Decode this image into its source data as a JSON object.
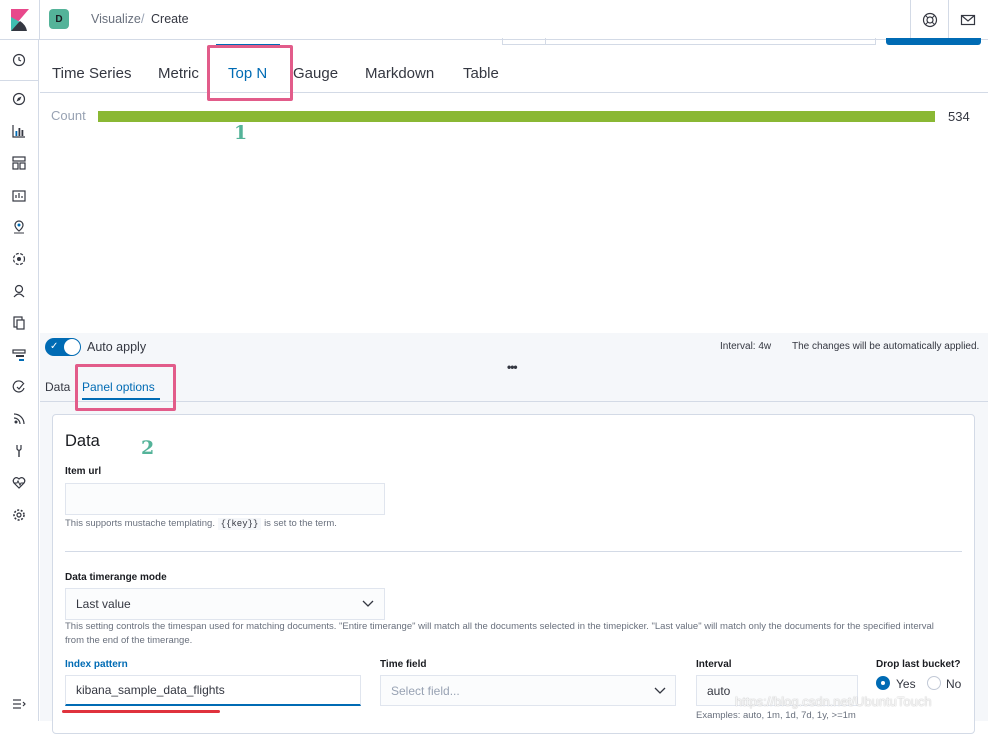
{
  "header": {
    "avatar_letter": "D",
    "breadcrumb_parent": "Visualize",
    "breadcrumb_separator": "/",
    "breadcrumb_current": "Create"
  },
  "viz_tabs": [
    "Time Series",
    "Metric",
    "Top N",
    "Gauge",
    "Markdown",
    "Table"
  ],
  "active_viz_tab": "Top N",
  "top_n": {
    "label": "Count",
    "value": "534",
    "bar_color": "#8ab834",
    "bar_fraction": 1.0
  },
  "annotations": {
    "first": "1",
    "second": "2"
  },
  "controls": {
    "auto_apply_label": "Auto apply",
    "auto_apply_on": true,
    "interval_text": "Interval: 4w",
    "changes_text": "The changes will be automatically applied."
  },
  "panel_tabs": {
    "data": "Data",
    "panel_options": "Panel options"
  },
  "panel": {
    "title": "Data",
    "item_url_label": "Item url",
    "item_url_value": "",
    "item_url_help_before": "This supports mustache templating.",
    "item_url_help_code": "{{key}}",
    "item_url_help_after": "is set to the term.",
    "timerange_label": "Data timerange mode",
    "timerange_value": "Last value",
    "timerange_help": "This setting controls the timespan used for matching documents. \"Entire timerange\" will match all the documents selected in the timepicker. \"Last value\" will match only the documents for the specified interval from the end of the timerange.",
    "index_pattern_label": "Index pattern",
    "index_pattern_value": "kibana_sample_data_flights",
    "time_field_label": "Time field",
    "time_field_placeholder": "Select field...",
    "interval_label": "Interval",
    "interval_value": "auto",
    "interval_help": "Examples: auto, 1m, 1d, 7d, 1y, >=1m",
    "drop_last_bucket_label": "Drop last bucket?",
    "drop_yes": "Yes",
    "drop_no": "No",
    "drop_last_bucket_value": "Yes"
  },
  "watermark": "https://blog.csdn.net/UbuntuTouch",
  "colors": {
    "accent": "#006bb4",
    "highlight": "#e25c8a",
    "annotation": "#54b399"
  }
}
